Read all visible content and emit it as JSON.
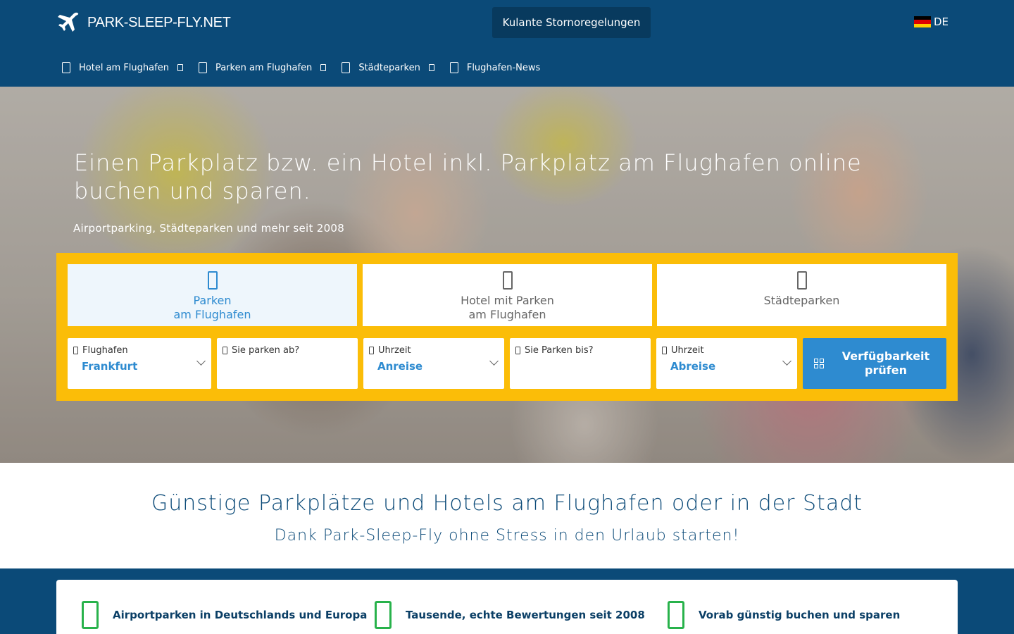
{
  "header": {
    "logo_text": "PARK-SLEEP-FLY.NET",
    "storno_label": "Kulante Stornoregelungen",
    "language": "DE",
    "flag_colors": [
      "#000000",
      "#dd0000",
      "#ffce00"
    ],
    "nav": [
      {
        "label": "Hotel am Flughafen",
        "icon": "hotel-icon",
        "has_dropdown": true
      },
      {
        "label": "Parken am Flughafen",
        "icon": "parking-icon",
        "has_dropdown": true
      },
      {
        "label": "Städteparken",
        "icon": "city-icon",
        "has_dropdown": true
      },
      {
        "label": "Flughafen-News",
        "icon": "news-icon",
        "has_dropdown": false
      }
    ]
  },
  "hero": {
    "title": "Einen Parkplatz bzw. ein Hotel inkl. Parkplatz am Flughafen online buchen und sparen.",
    "subtitle": "Airportparking, Städteparken und mehr seit 2008"
  },
  "search": {
    "tabs": [
      {
        "line1": "Parken",
        "line2": "am Flughafen",
        "icon": "car-icon",
        "active": true
      },
      {
        "line1": "Hotel mit Parken",
        "line2": "am Flughafen",
        "icon": "bed-icon",
        "active": false
      },
      {
        "line1": "Städteparken",
        "line2": "",
        "icon": "building-icon",
        "active": false
      }
    ],
    "fields": {
      "airport": {
        "label": "Flughafen",
        "value": "Frankfurt",
        "icon": "plane-icon"
      },
      "park_from": {
        "label": "Sie parken ab?",
        "value": "",
        "icon": "calendar-icon"
      },
      "time_arrival": {
        "label": "Uhrzeit",
        "value": "Anreise",
        "icon": "clock-icon"
      },
      "park_until": {
        "label": "Sie Parken bis?",
        "value": "",
        "icon": "calendar-icon"
      },
      "time_departure": {
        "label": "Uhrzeit",
        "value": "Abreise",
        "icon": "clock-icon"
      }
    },
    "submit_label": "Verfügbarkeit prüfen"
  },
  "intro": {
    "title": "Günstige Parkplätze und Hotels am Flughafen oder in der Stadt",
    "subtitle": "Dank Park-Sleep-Fly ohne Stress in den Urlaub starten!"
  },
  "features": [
    {
      "text": "Airportparken in Deutschlands und Europa",
      "icon": "check-icon"
    },
    {
      "text": "Tausende, echte Bewertungen seit 2008",
      "icon": "check-icon"
    },
    {
      "text": "Vorab günstig buchen und sparen",
      "icon": "check-icon"
    }
  ],
  "colors": {
    "primary": "#0b4a78",
    "accent": "#2e8bd0",
    "search_bg": "#fbbd08",
    "feature_icon": "#28b24b"
  }
}
